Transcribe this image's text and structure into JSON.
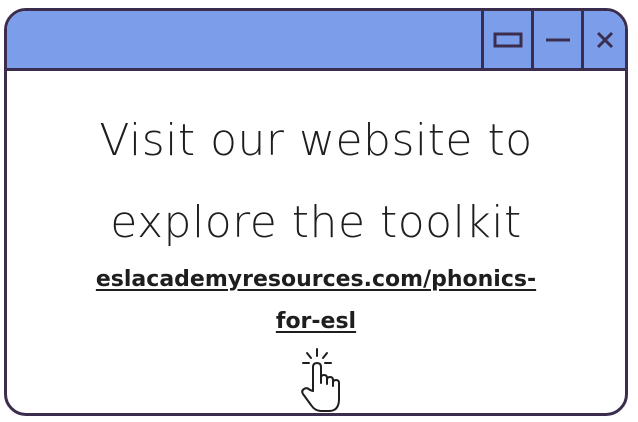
{
  "window": {
    "controls": {
      "maximize_icon": "maximize-icon",
      "minimize_icon": "minimize-icon",
      "close_icon": "close-icon",
      "close_glyph": "✕"
    }
  },
  "content": {
    "headline_line1": "Visit our website to",
    "headline_line2": "explore the toolkit",
    "link_line1": "eslacademyresources.com/phonics-",
    "link_line2": "for-esl",
    "pointer_icon": "hand-pointer-click-icon"
  },
  "colors": {
    "titlebar": "#7c9eea",
    "border": "#3b2d4d",
    "text": "#1e1e1e",
    "background": "#ffffff"
  }
}
